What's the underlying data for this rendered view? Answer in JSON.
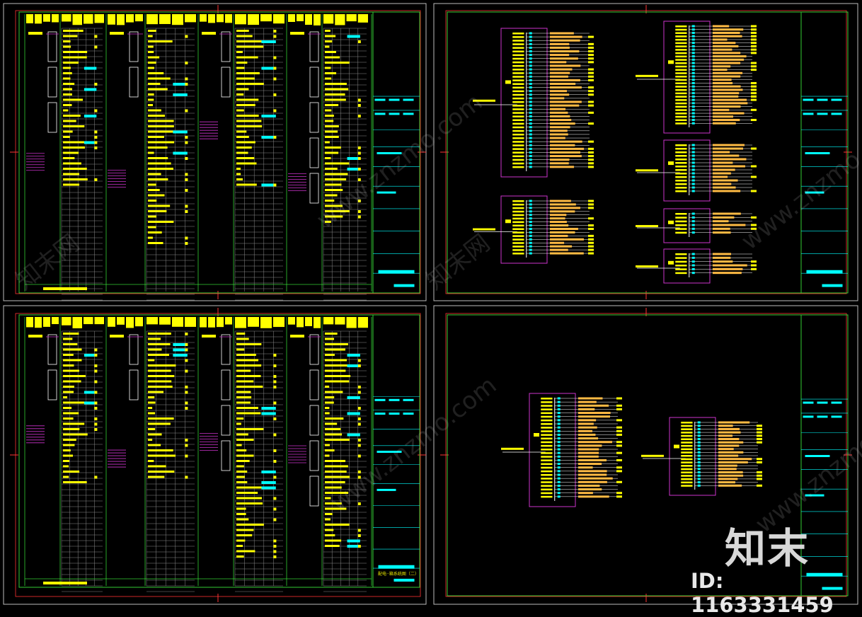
{
  "drawing": {
    "background": "#000000",
    "colors": {
      "frame_green": "#33cc33",
      "frame_red": "#ff3333",
      "frame_grey": "#bdbdbd",
      "yellow": "#ffff00",
      "cyan": "#00ffff",
      "magenta": "#cc33cc",
      "orange": "#ffbb44",
      "white": "#ffffff",
      "grid_grey": "#8a8a8a"
    },
    "sheets": [
      {
        "id": "top-left",
        "kind": "riser-table"
      },
      {
        "id": "top-right",
        "kind": "box-diagrams"
      },
      {
        "id": "bottom-left",
        "kind": "riser-table"
      },
      {
        "id": "bottom-right",
        "kind": "box-diagrams"
      }
    ],
    "bottom_left_sheet_title": "配电··箱系统图（二）"
  },
  "watermark": {
    "brand_cn": "知末",
    "id_label": "ID: 1163331459",
    "site": "www.znzmo.com",
    "site_cn": "知末网"
  }
}
